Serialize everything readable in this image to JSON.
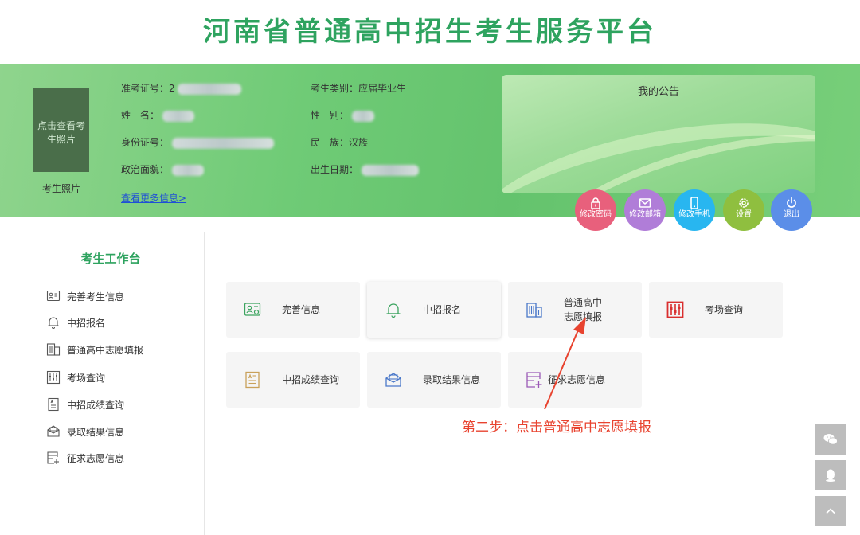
{
  "page_title": "河南省普通高中招生考生服务平台",
  "profile": {
    "photo_button": "点击查看考生照片",
    "photo_caption": "考生照片",
    "exam_no_label": "准考证号：",
    "exam_no_visible": "2",
    "name_label": "姓　名：",
    "id_label": "身份证号：",
    "politics_label": "政治面貌：",
    "category_label": "考生类别：",
    "category_value": "应届毕业生",
    "gender_label": "性　别：",
    "ethnic_label": "民　族：",
    "ethnic_value": "汉族",
    "birth_label": "出生日期：",
    "more_link": "查看更多信息>"
  },
  "notice": {
    "title": "我的公告"
  },
  "actions": [
    {
      "label": "修改密码",
      "color": "#e8607c",
      "icon": "lock-icon"
    },
    {
      "label": "修改邮箱",
      "color": "#b07dd8",
      "icon": "mail-icon"
    },
    {
      "label": "修改手机",
      "color": "#28b6f0",
      "icon": "phone-icon"
    },
    {
      "label": "设置",
      "color": "#8fbf3f",
      "icon": "gear-icon"
    },
    {
      "label": "退出",
      "color": "#5b8ee8",
      "icon": "power-icon"
    }
  ],
  "sidebar": {
    "title": "考生工作台",
    "items": [
      {
        "label": "完善考生信息",
        "icon": "profile-card-icon"
      },
      {
        "label": "中招报名",
        "icon": "bell-icon"
      },
      {
        "label": "普通高中志愿填报",
        "icon": "building-icon"
      },
      {
        "label": "考场查询",
        "icon": "exam-room-icon"
      },
      {
        "label": "中招成绩查询",
        "icon": "score-doc-icon"
      },
      {
        "label": "录取结果信息",
        "icon": "envelope-icon"
      },
      {
        "label": "征求志愿信息",
        "icon": "form-add-icon"
      }
    ]
  },
  "cards": [
    {
      "label": "完善信息",
      "icon": "profile-card-icon",
      "color": "#3aa35e"
    },
    {
      "label": "中招报名",
      "icon": "bell-icon",
      "color": "#3aa35e"
    },
    {
      "label_line1": "普通高中",
      "label_line2": "志愿填报",
      "icon": "building-icon",
      "color": "#4a78c9"
    },
    {
      "label": "考场查询",
      "icon": "exam-room-icon",
      "color": "#d92f2f"
    },
    {
      "label": "中招成绩查询",
      "icon": "score-doc-icon",
      "color": "#c9a15a"
    },
    {
      "label": "录取结果信息",
      "icon": "envelope-icon",
      "color": "#4a78c9"
    },
    {
      "label": "征求志愿信息",
      "icon": "form-add-icon",
      "color": "#9b59b6"
    }
  ],
  "annotation": {
    "text": "第二步：点击普通高中志愿填报",
    "color": "#e8432f"
  },
  "floating": [
    {
      "icon": "wechat-icon"
    },
    {
      "icon": "qq-icon"
    },
    {
      "icon": "back-to-top-icon"
    }
  ]
}
